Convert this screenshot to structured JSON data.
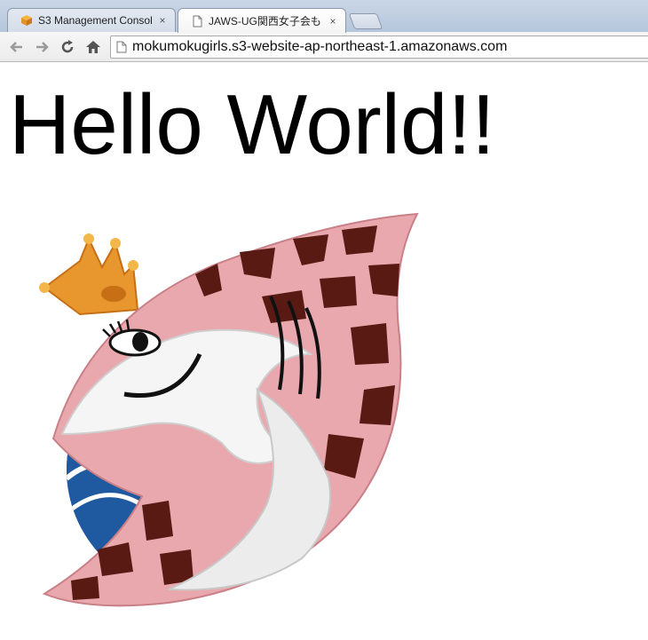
{
  "browser": {
    "tabs": [
      {
        "label": "S3 Management Consol",
        "active": false
      },
      {
        "label": "JAWS-UG関西女子会も",
        "active": true
      }
    ],
    "close_glyph": "×",
    "address_bar": {
      "url": "mokumokugirls.s3-website-ap-northeast-1.amazonaws.com"
    }
  },
  "page": {
    "heading": "Hello World!!"
  }
}
